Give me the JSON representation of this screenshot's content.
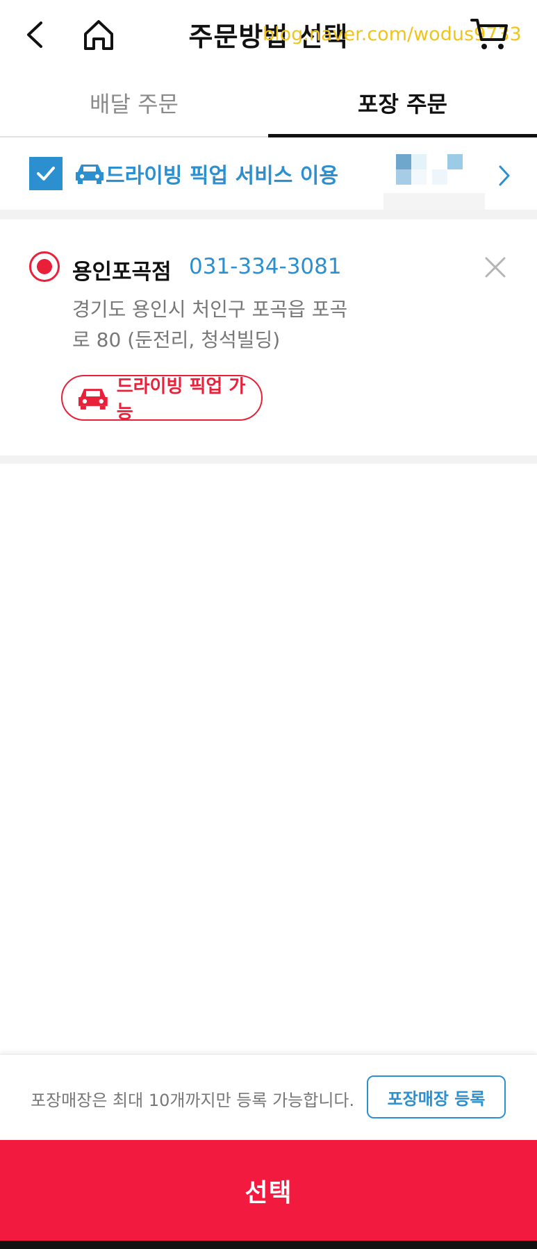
{
  "header": {
    "title": "주문방법 선택",
    "watermark": "blog.naver.com/wodus9733"
  },
  "tabs": [
    {
      "label": "배달 주문",
      "active": false
    },
    {
      "label": "포장 주문",
      "active": true
    }
  ],
  "drive_pickup": {
    "checked": true,
    "label": "드라이빙 픽업 서비스 이용"
  },
  "store": {
    "name": "용인포곡점",
    "phone": "031-334-3081",
    "address": "경기도 용인시 처인구 포곡읍 포곡로 80 (둔전리, 청석빌딩)",
    "badge": "드라이빙 픽업 가능"
  },
  "footer": {
    "limit_text": "포장매장은 최대 10개까지만 등록 가능합니다.",
    "register_button": "포장매장 등록",
    "select_button": "선택"
  },
  "colors": {
    "accent_blue": "#2b8fd0",
    "accent_red": "#e8203a",
    "select_red": "#f21b3f"
  }
}
